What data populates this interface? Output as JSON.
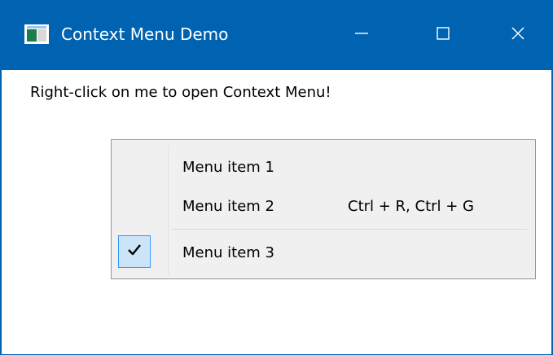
{
  "window": {
    "title": "Context Menu Demo",
    "accent_color": "#0063b1",
    "icons": {
      "app": "app-window-icon",
      "minimize": "minimize-icon",
      "maximize": "maximize-icon",
      "close": "close-icon"
    }
  },
  "main": {
    "label": "Right-click on me to open Context Menu!"
  },
  "context_menu": {
    "items": [
      {
        "label": "Menu item 1",
        "shortcut": "",
        "checked": false
      },
      {
        "label": "Menu item 2",
        "shortcut": "Ctrl + R, Ctrl + G",
        "checked": false
      },
      {
        "label": "Menu item 3",
        "shortcut": "",
        "checked": true,
        "check_icon": "checkmark-icon"
      }
    ]
  }
}
